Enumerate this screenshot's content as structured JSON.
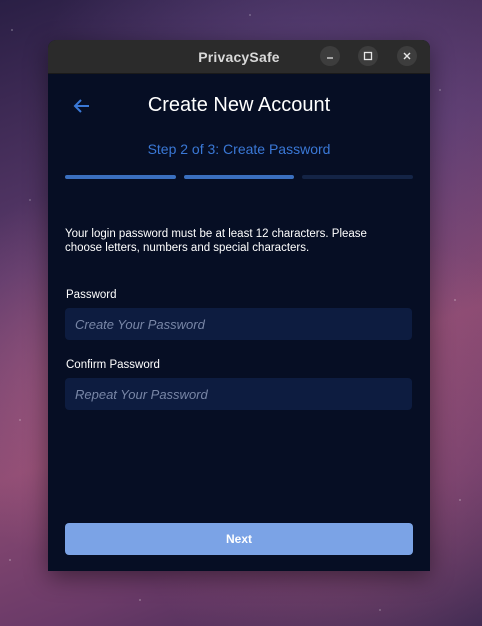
{
  "window": {
    "title": "PrivacySafe",
    "controls": {
      "minimize": "–",
      "maximize": "□",
      "close": "✕"
    }
  },
  "header": {
    "back_icon": "arrow-left-icon",
    "title": "Create New Account",
    "step": "Step 2 of 3: Create Password"
  },
  "progress": {
    "current": 2,
    "total": 3
  },
  "form": {
    "description": "Your login password must be at least 12 characters. Please choose letters, numbers and special characters.",
    "password_label": "Password",
    "password_placeholder": "Create Your Password",
    "password_value": "",
    "confirm_label": "Confirm Password",
    "confirm_placeholder": "Repeat Your Password",
    "confirm_value": ""
  },
  "actions": {
    "next_label": "Next"
  },
  "colors": {
    "background": "#060e24",
    "accent": "#3a78d6",
    "field_bg": "#0d1c40",
    "button_bg": "#7ba3e6"
  }
}
